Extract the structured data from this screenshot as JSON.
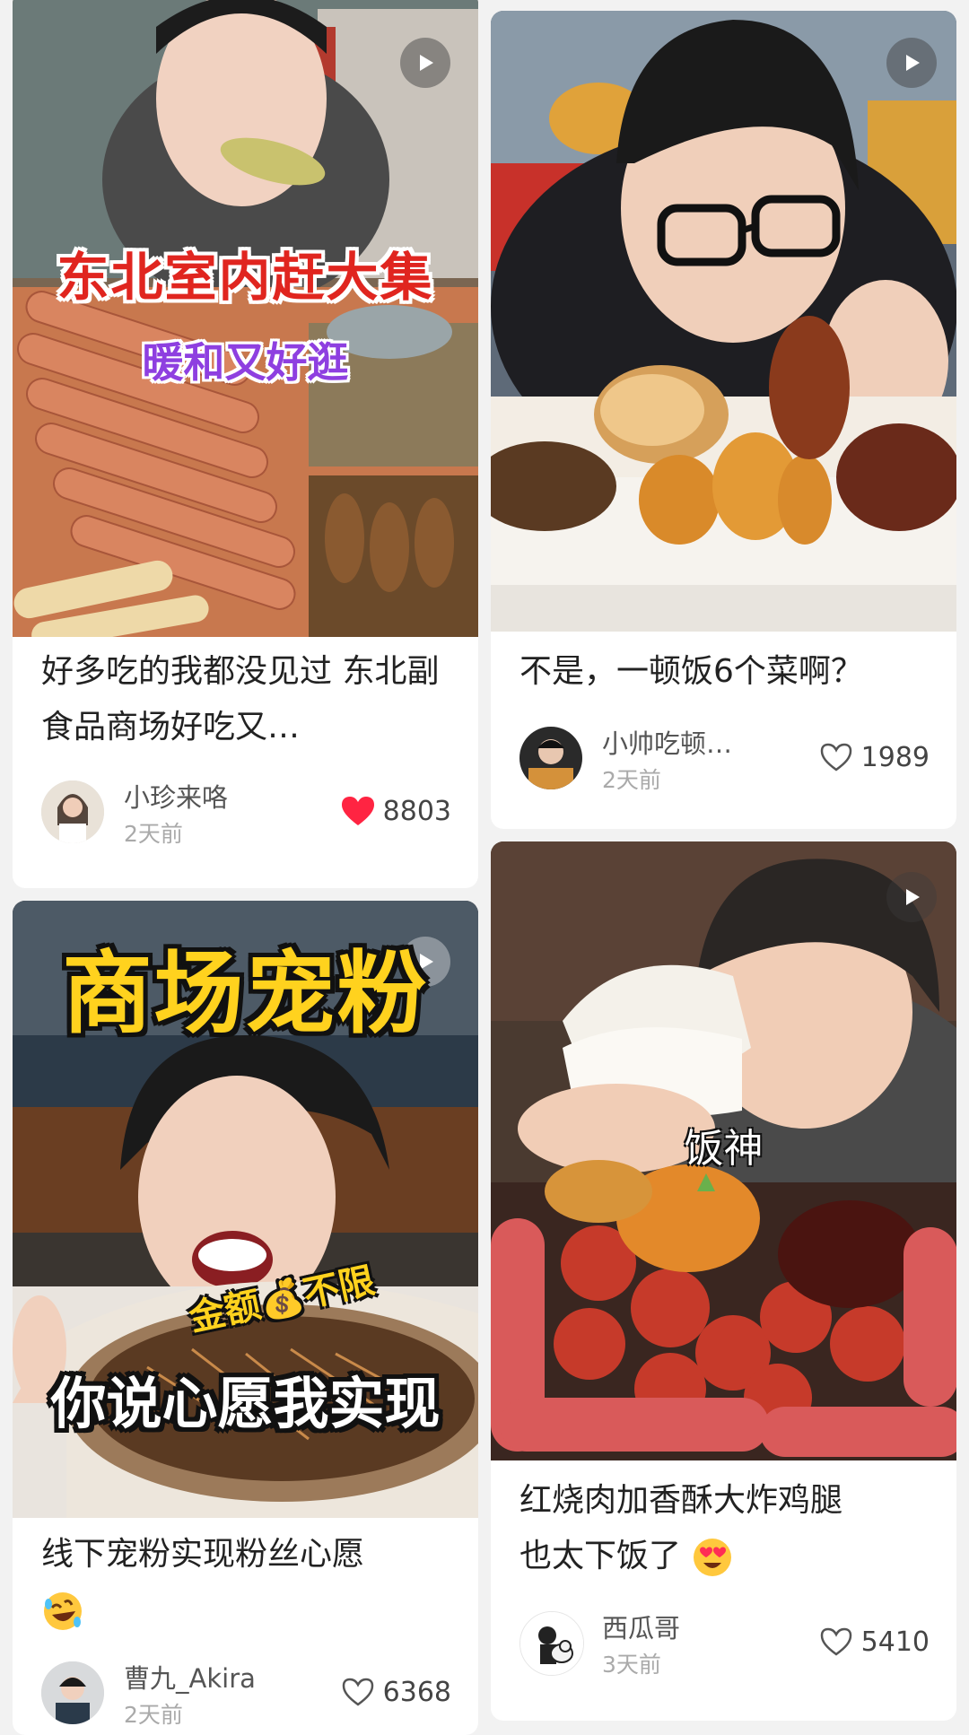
{
  "feed": {
    "cards": [
      {
        "overlay_title": "东北室内赶大集",
        "overlay_subtitle": "暖和又好逛",
        "title": "好多吃的我都没见过 东北副食品商场好吃又…",
        "author": "小珍来咯",
        "time": "2天前",
        "likes": "8803",
        "liked": true
      },
      {
        "title": "不是，一顿饭6个菜啊？",
        "author": "小帅吃顿…",
        "time": "2天前",
        "likes": "1989",
        "liked": false
      },
      {
        "overlay_top": "商场宠粉",
        "overlay_amount": "金额💰不限",
        "overlay_bottom": "你说心愿我实现",
        "title": "线下宠粉实现粉丝心愿",
        "title_emoji": "rolling-on-floor-laughing-emoji",
        "author": "曹九_Akira",
        "time": "2天前",
        "likes": "6368",
        "liked": false
      },
      {
        "overlay_caption": "饭神",
        "title_line1": "红烧肉加香酥大炸鸡腿",
        "title_line2": "也太下饭了",
        "title_emoji": "heart-eyes-emoji",
        "author": "西瓜哥",
        "time": "3天前",
        "likes": "5410",
        "liked": false
      }
    ]
  },
  "colors": {
    "liked_heart": "#ff2442",
    "unliked_heart": "#555555",
    "background": "#f2f2f2"
  }
}
